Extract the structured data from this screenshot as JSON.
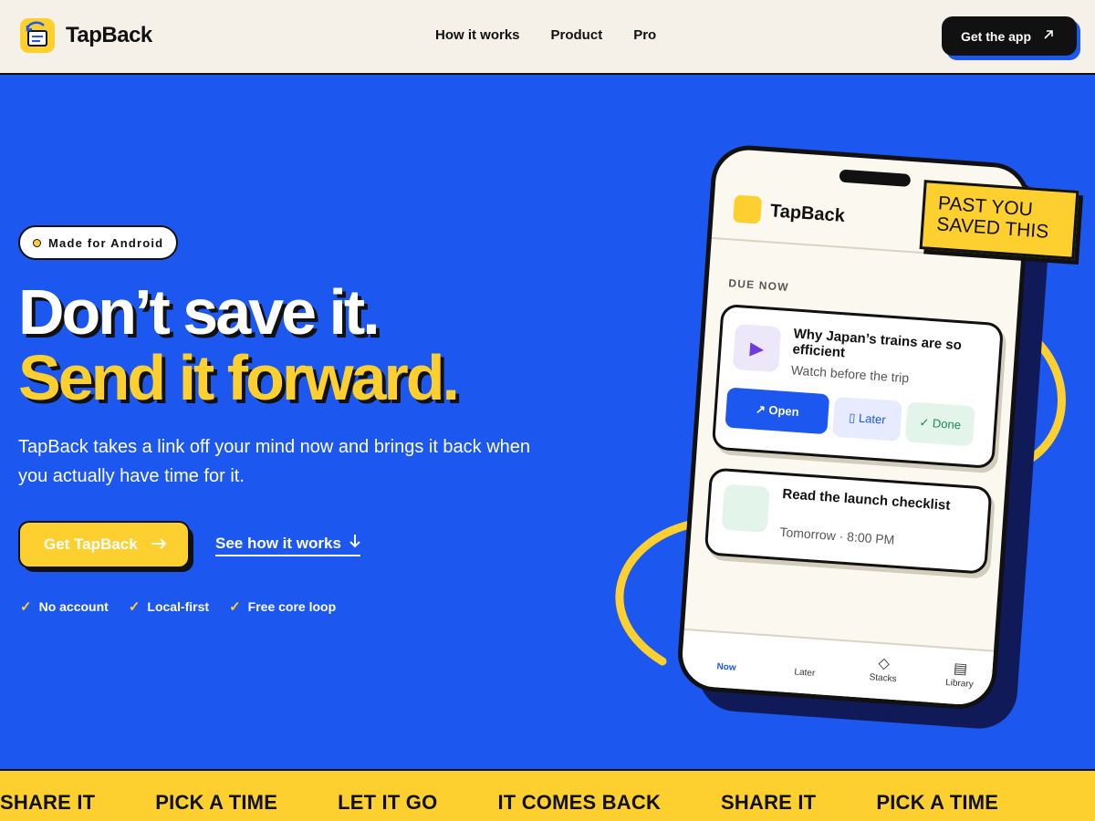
{
  "header": {
    "brand": "TapBack",
    "nav": [
      "How it works",
      "Product",
      "Pro"
    ],
    "cta_label": "Get the app",
    "cta_icon": "arrow-up-right-icon"
  },
  "hero": {
    "badge": "Made for Android",
    "headline_line1": "Don’t save it.",
    "headline_line2": "Send it forward.",
    "lead": "TapBack takes a link off your mind now and brings it back when you actually have time for it.",
    "primary_cta": "Get TapBack",
    "primary_cta_icon": "arrow-right-icon",
    "secondary_cta": "See how it works",
    "secondary_cta_icon": "arrow-down-icon",
    "checks": [
      "No account",
      "Local-first",
      "Free core loop"
    ]
  },
  "phone": {
    "brand": "TapBack",
    "section_label": "DUE NOW",
    "card1": {
      "title": "Why Japan’s trains are so efficient",
      "subtitle": "Watch before the trip",
      "open_label": "↗ Open",
      "later_label": "▯ Later",
      "done_label": "✓ Done"
    },
    "card2": {
      "title": "Read the launch checklist",
      "subtitle": "Tomorrow · 8:00 PM"
    },
    "tabs": [
      {
        "label": "Now",
        "icon": ""
      },
      {
        "label": "Later",
        "icon": ""
      },
      {
        "label": "Stacks",
        "icon": "◇"
      },
      {
        "label": "Library",
        "icon": "▤"
      }
    ]
  },
  "sticker": {
    "line1": "PAST YOU",
    "line2": "SAVED THIS"
  },
  "ticker": [
    "SHARE IT",
    "PICK A TIME",
    "LET IT GO",
    "IT COMES BACK",
    "SHARE IT",
    "PICK A TIME"
  ],
  "colors": {
    "brand_blue": "#1c58ef",
    "accent_yellow": "#fdd02f",
    "ink": "#111111",
    "cream": "#f5f1e8"
  }
}
